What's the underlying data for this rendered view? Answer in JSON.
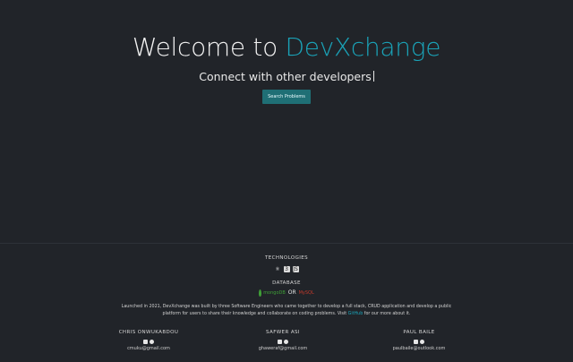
{
  "hero": {
    "title_prefix": "Welcome to ",
    "title_brand": "DevXchange",
    "subtitle": "Connect with other developers",
    "search_button": "Search Problems"
  },
  "footer": {
    "technologies_title": "TECHNOLOGIES",
    "technologies": [
      "react-icon",
      "css3-icon",
      "javascript-icon"
    ],
    "tech_glyphs": [
      "⚛",
      "3",
      "JS"
    ],
    "database_title": "DATABASE",
    "db_primary": "mongoDB",
    "db_or": "OR",
    "db_secondary": "MySQL",
    "description_before": "Launched in 2021, DevXchange was built by three Software Engineers who came together to develop a full stack, CRUD application and develop a public platform for users to share their knowledge and collaborate on coding problems. Visit ",
    "description_link": "GitHub",
    "description_after": " for our more about it.",
    "members": [
      {
        "name": "CHRIS ONWUKABDOU",
        "email": "cmuku@gmail.com"
      },
      {
        "name": "SAFWER ASI",
        "email": "ghaweraf@gmail.com"
      },
      {
        "name": "PAUL BAILE",
        "email": "paulbaile@outlook.com"
      }
    ],
    "colors": {
      "accent": "#1aa3b8",
      "mongo": "#3fa037",
      "mysql": "#c0392b",
      "background": "#212429"
    }
  }
}
